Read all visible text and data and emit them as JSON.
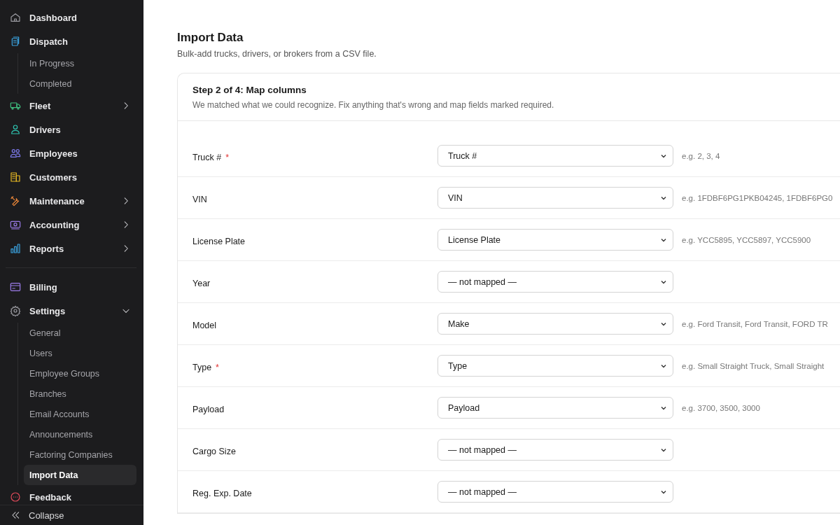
{
  "sidebar": {
    "groups": [
      {
        "items": [
          {
            "label": "Dashboard",
            "selected": false
          },
          {
            "label": "Dispatch",
            "selected": false,
            "children": [
              {
                "label": "In Progress",
                "selected": false
              },
              {
                "label": "Completed",
                "selected": false
              }
            ]
          },
          {
            "label": "Fleet",
            "selected": false,
            "expanded": false
          },
          {
            "label": "Drivers",
            "selected": false
          },
          {
            "label": "Employees",
            "selected": false
          },
          {
            "label": "Customers",
            "selected": false
          },
          {
            "label": "Maintenance",
            "selected": false,
            "expanded": false
          },
          {
            "label": "Accounting",
            "selected": false,
            "expanded": false
          },
          {
            "label": "Reports",
            "selected": false,
            "expanded": false
          }
        ]
      },
      {
        "items": [
          {
            "label": "Billing",
            "selected": false
          },
          {
            "label": "Settings",
            "selected": false,
            "expanded": true,
            "children": [
              {
                "label": "General",
                "selected": false
              },
              {
                "label": "Users",
                "selected": false
              },
              {
                "label": "Employee Groups",
                "selected": false
              },
              {
                "label": "Branches",
                "selected": false
              },
              {
                "label": "Email Accounts",
                "selected": false
              },
              {
                "label": "Announcements",
                "selected": false
              },
              {
                "label": "Factoring Companies",
                "selected": false
              },
              {
                "label": "Import Data",
                "selected": true
              }
            ]
          },
          {
            "label": "Feedback",
            "selected": false
          }
        ]
      }
    ],
    "footer": {
      "label": "Collapse"
    }
  },
  "page": {
    "title": "Import Data",
    "subtitle": "Bulk-add trucks, drivers, or brokers from a CSV file."
  },
  "card": {
    "title": "Step 2 of 4: Map columns",
    "subtitle": "We matched what we could recognize. Fix anything that's wrong and map fields marked required.",
    "rows": [
      {
        "label": "Truck #",
        "required_mark": "*",
        "mapping": "Truck #",
        "hint": "e.g. 2, 3, 4"
      },
      {
        "label": "VIN",
        "mapping": "VIN",
        "hint": "e.g. 1FDBF6PG1PKB04245, 1FDBF6PG0"
      },
      {
        "label": "License Plate",
        "mapping": "License Plate",
        "hint": "e.g. YCC5895, YCC5897, YCC5900"
      },
      {
        "label": "Year",
        "mapping": "— not mapped —"
      },
      {
        "label": "Model",
        "mapping": "Make",
        "hint": "e.g. Ford Transit, Ford Transit, FORD TR"
      },
      {
        "label": "Type",
        "required_mark": "*",
        "mapping": "Type",
        "hint": "e.g. Small Straight Truck, Small Straight"
      },
      {
        "label": "Payload",
        "mapping": "Payload",
        "hint": "e.g. 3700, 3500, 3000"
      },
      {
        "label": "Cargo Size",
        "mapping": "— not mapped —"
      },
      {
        "label": "Reg. Exp. Date",
        "mapping": "— not mapped —"
      }
    ]
  }
}
